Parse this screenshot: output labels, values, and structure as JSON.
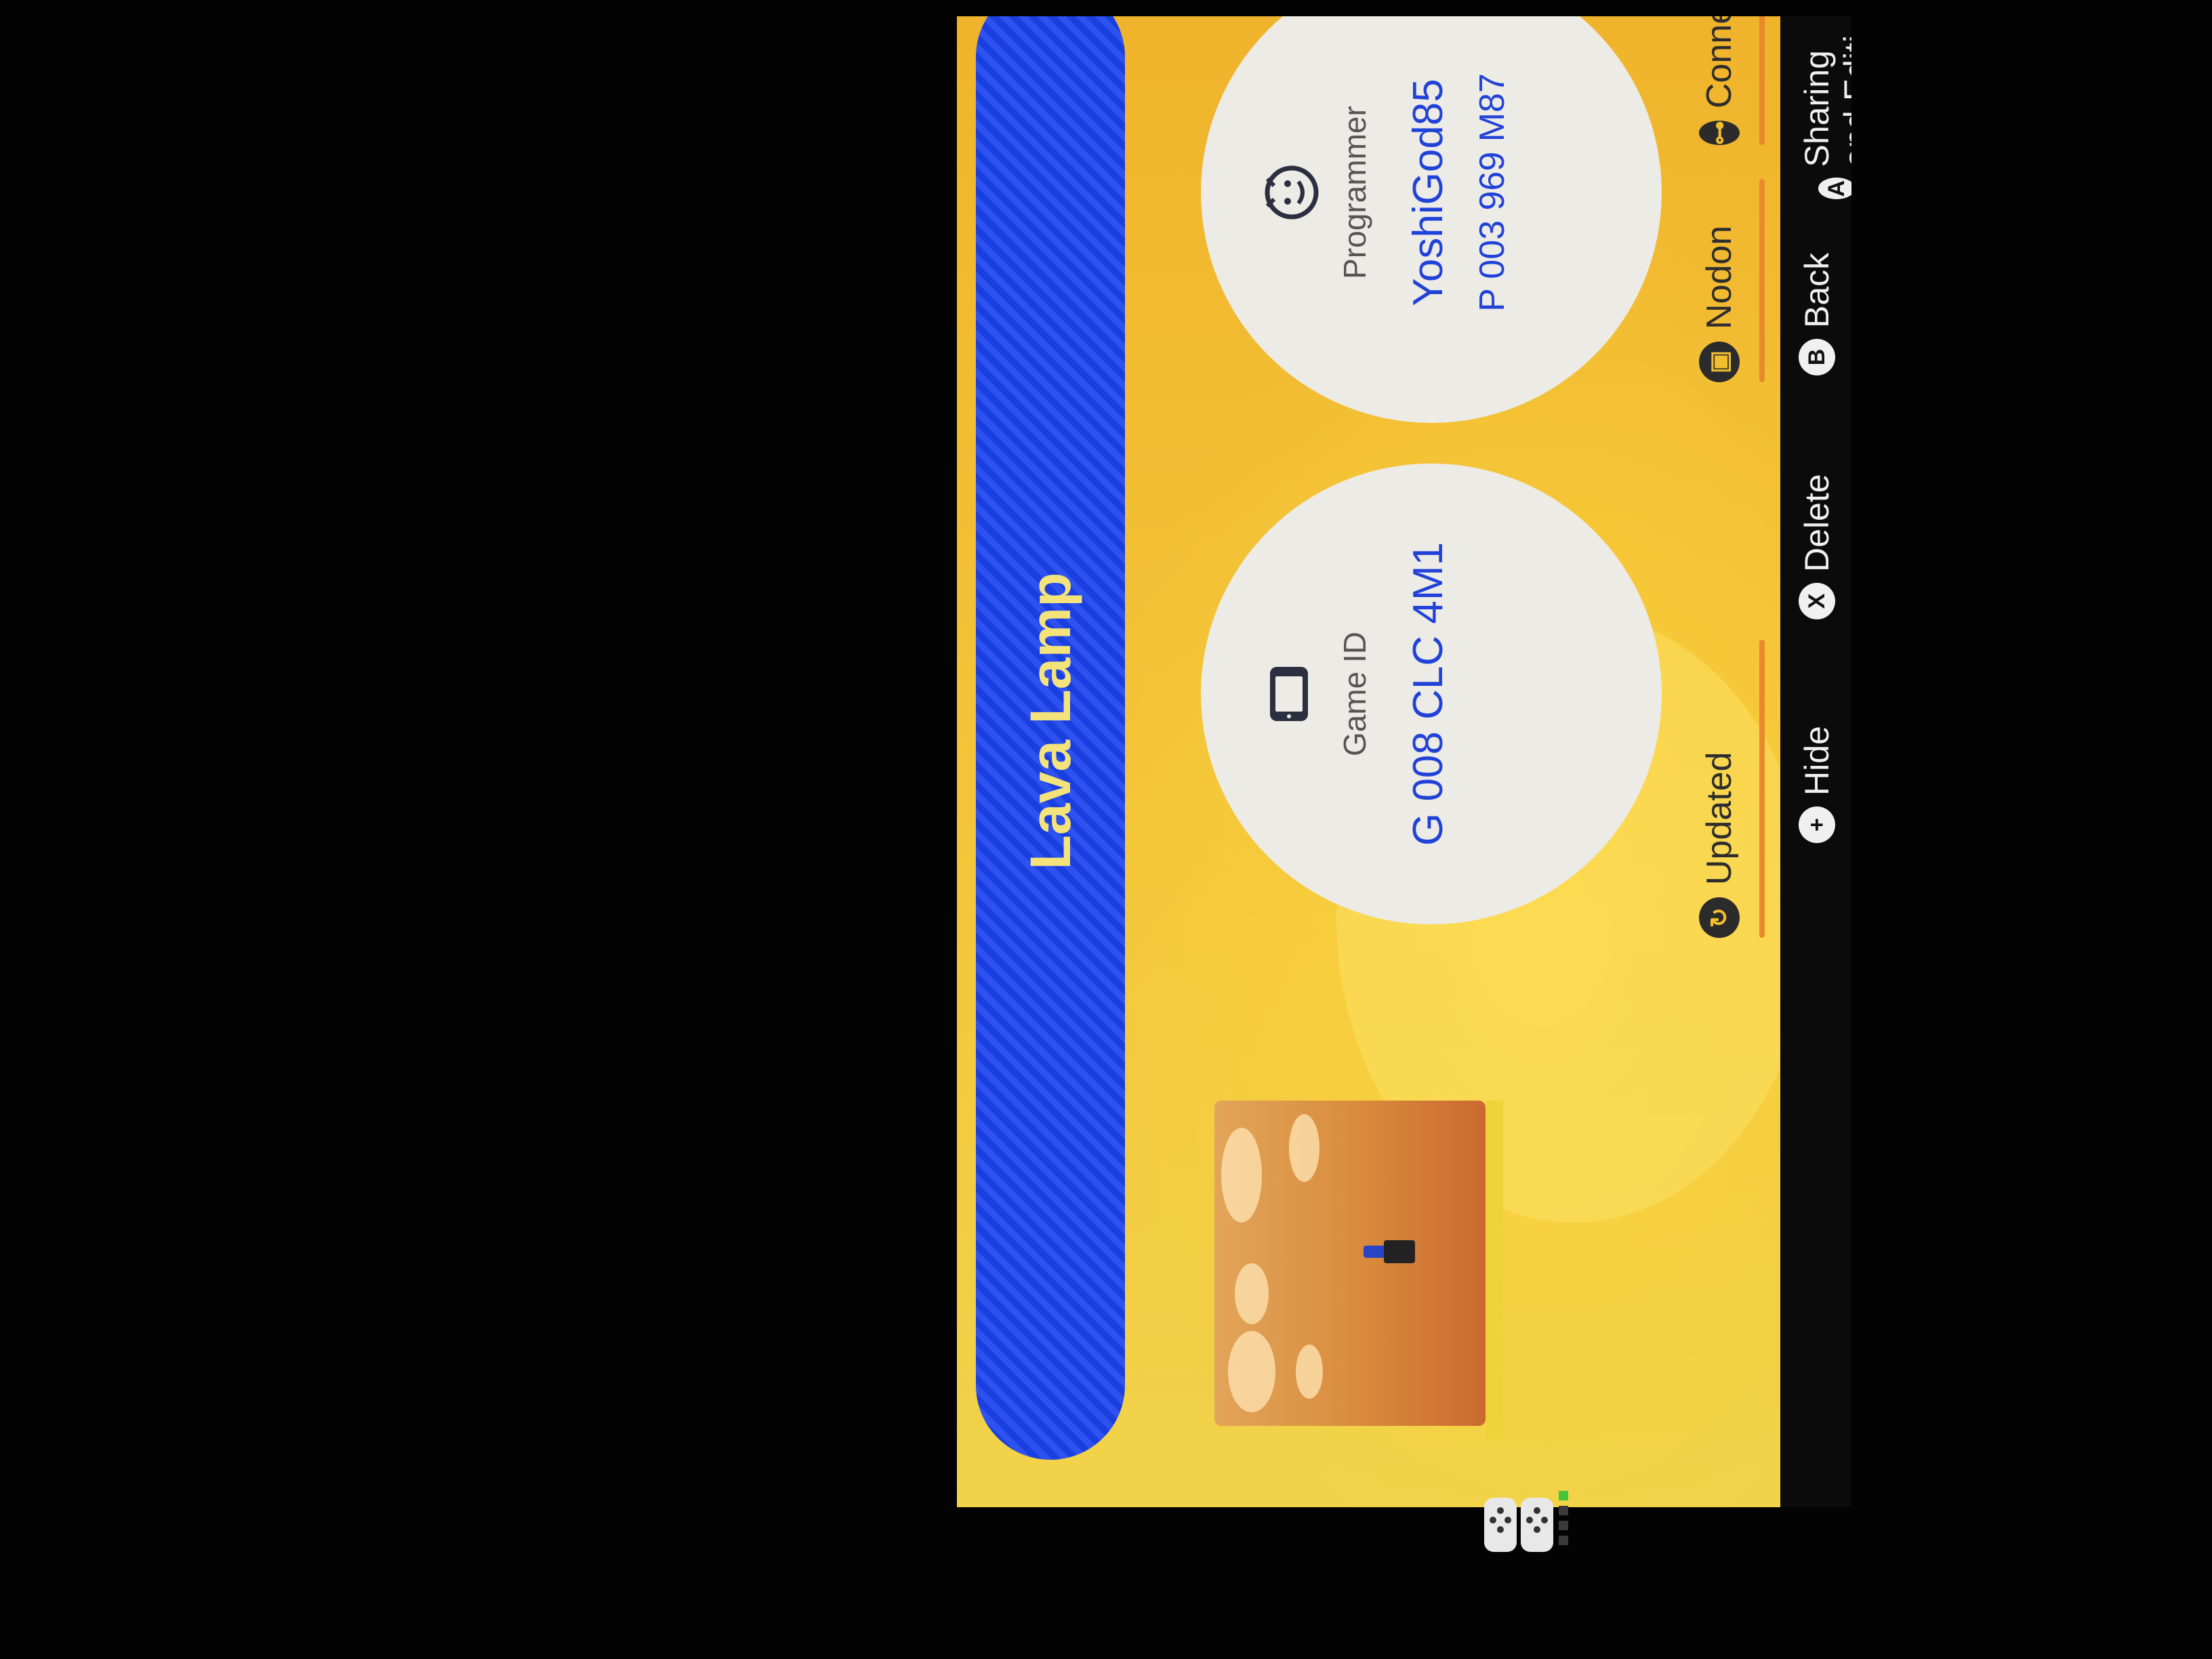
{
  "game": {
    "title": "Lava Lamp"
  },
  "game_id_card": {
    "label": "Game ID",
    "value": "G 008 CLC 4M1",
    "icon": "handheld-console-icon"
  },
  "programmer_card": {
    "label": "Programmer",
    "name": "YoshiGod85",
    "id": "P 003 969 M87",
    "icon": "smiley-face-icon"
  },
  "tabs": [
    {
      "label": "Updated",
      "icon": "refresh-icon"
    },
    {
      "label": "Nodon",
      "icon": "nodon-icon"
    },
    {
      "label": "Connections",
      "icon": "connections-icon"
    }
  ],
  "footer": {
    "hide": {
      "glyph": "+",
      "label": "Hide"
    },
    "delete": {
      "glyph": "X",
      "label": "Delete"
    },
    "back": {
      "glyph": "B",
      "label": "Back"
    },
    "sharing": {
      "glyph": "A",
      "label": "Sharing and Editi"
    }
  },
  "colors": {
    "background": "#f2be2e",
    "title_bar": "#1a3fe0",
    "title_text": "#f4e27a",
    "accent_text": "#2142d9",
    "card": "#ecebe6",
    "footer": "#0b0b0b"
  }
}
